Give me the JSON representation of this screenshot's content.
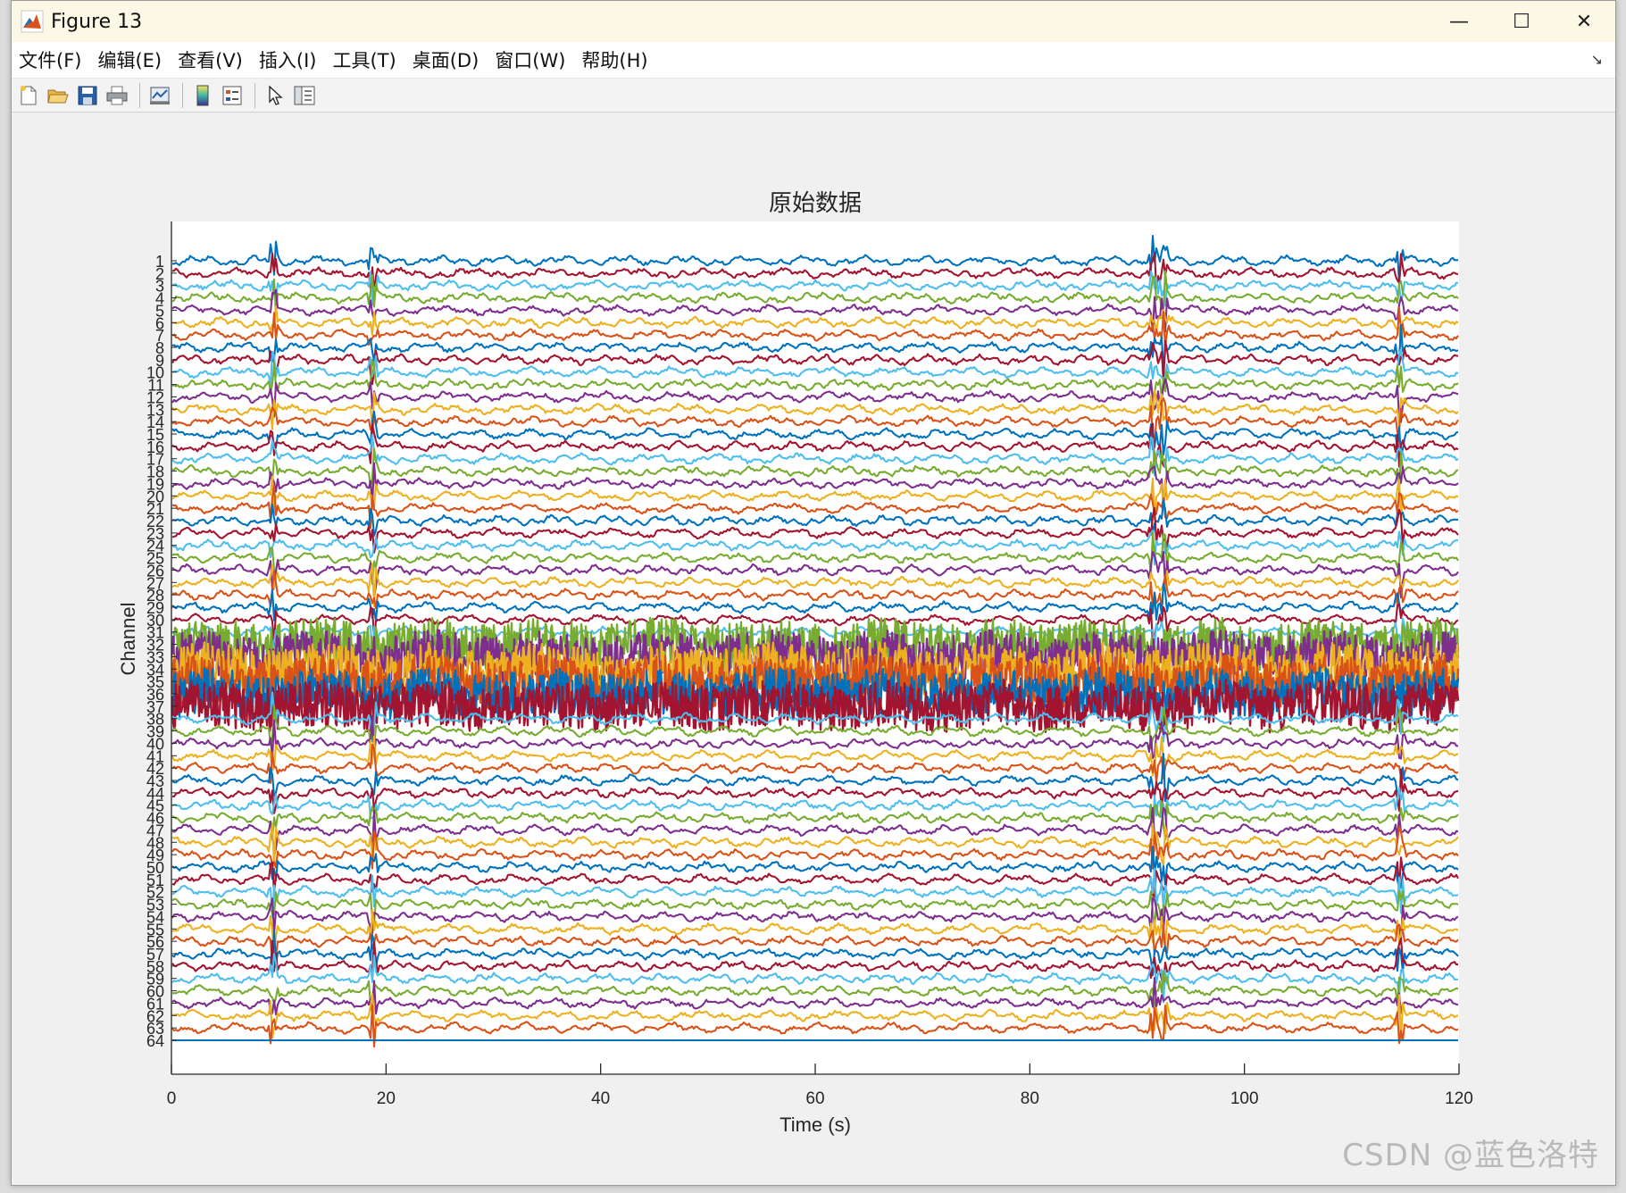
{
  "window": {
    "title": "Figure 13",
    "controls": {
      "minimize": "—",
      "maximize": "☐",
      "close": "✕"
    }
  },
  "menu": {
    "items": [
      "文件(F)",
      "编辑(E)",
      "查看(V)",
      "插入(I)",
      "工具(T)",
      "桌面(D)",
      "窗口(W)",
      "帮助(H)"
    ],
    "overflow": "↘"
  },
  "toolbar": {
    "icons": [
      "new-figure-icon",
      "open-file-icon",
      "save-icon",
      "print-icon",
      "link-plot-icon",
      "colorbar-icon",
      "legend-icon",
      "pointer-icon",
      "property-inspector-icon"
    ]
  },
  "chart_data": {
    "type": "line",
    "title": "原始数据",
    "xlabel": "Time (s)",
    "ylabel": "Channel",
    "xlim": [
      0,
      120
    ],
    "xticks": [
      0,
      20,
      40,
      60,
      80,
      100,
      120
    ],
    "channels": 64,
    "yticklabels": [
      "1",
      "2",
      "3",
      "4",
      "5",
      "6",
      "7",
      "8",
      "9",
      "10",
      "11",
      "12",
      "13",
      "14",
      "15",
      "16",
      "17",
      "18",
      "19",
      "20",
      "21",
      "22",
      "23",
      "24",
      "25",
      "26",
      "27",
      "28",
      "29",
      "30",
      "31",
      "32",
      "33",
      "34",
      "35",
      "36",
      "37",
      "38",
      "39",
      "40",
      "41",
      "42",
      "43",
      "44",
      "45",
      "46",
      "47",
      "48",
      "49",
      "50",
      "51",
      "52",
      "53",
      "54",
      "55",
      "56",
      "57",
      "58",
      "59",
      "60",
      "61",
      "62",
      "63",
      "64"
    ],
    "series_colors": [
      "#0072BD",
      "#A2142F",
      "#4DBEEE",
      "#77AC30",
      "#7E2F8E",
      "#EDB120",
      "#D95319"
    ],
    "noisy_channels": [
      32,
      33,
      34,
      35,
      36,
      37
    ],
    "flat_channels": [
      64
    ],
    "artifact_times": [
      9.5,
      18.8,
      91.5,
      92.5,
      114.5
    ],
    "grid": false,
    "legend": "none"
  },
  "watermark": "CSDN @蓝色洛特"
}
